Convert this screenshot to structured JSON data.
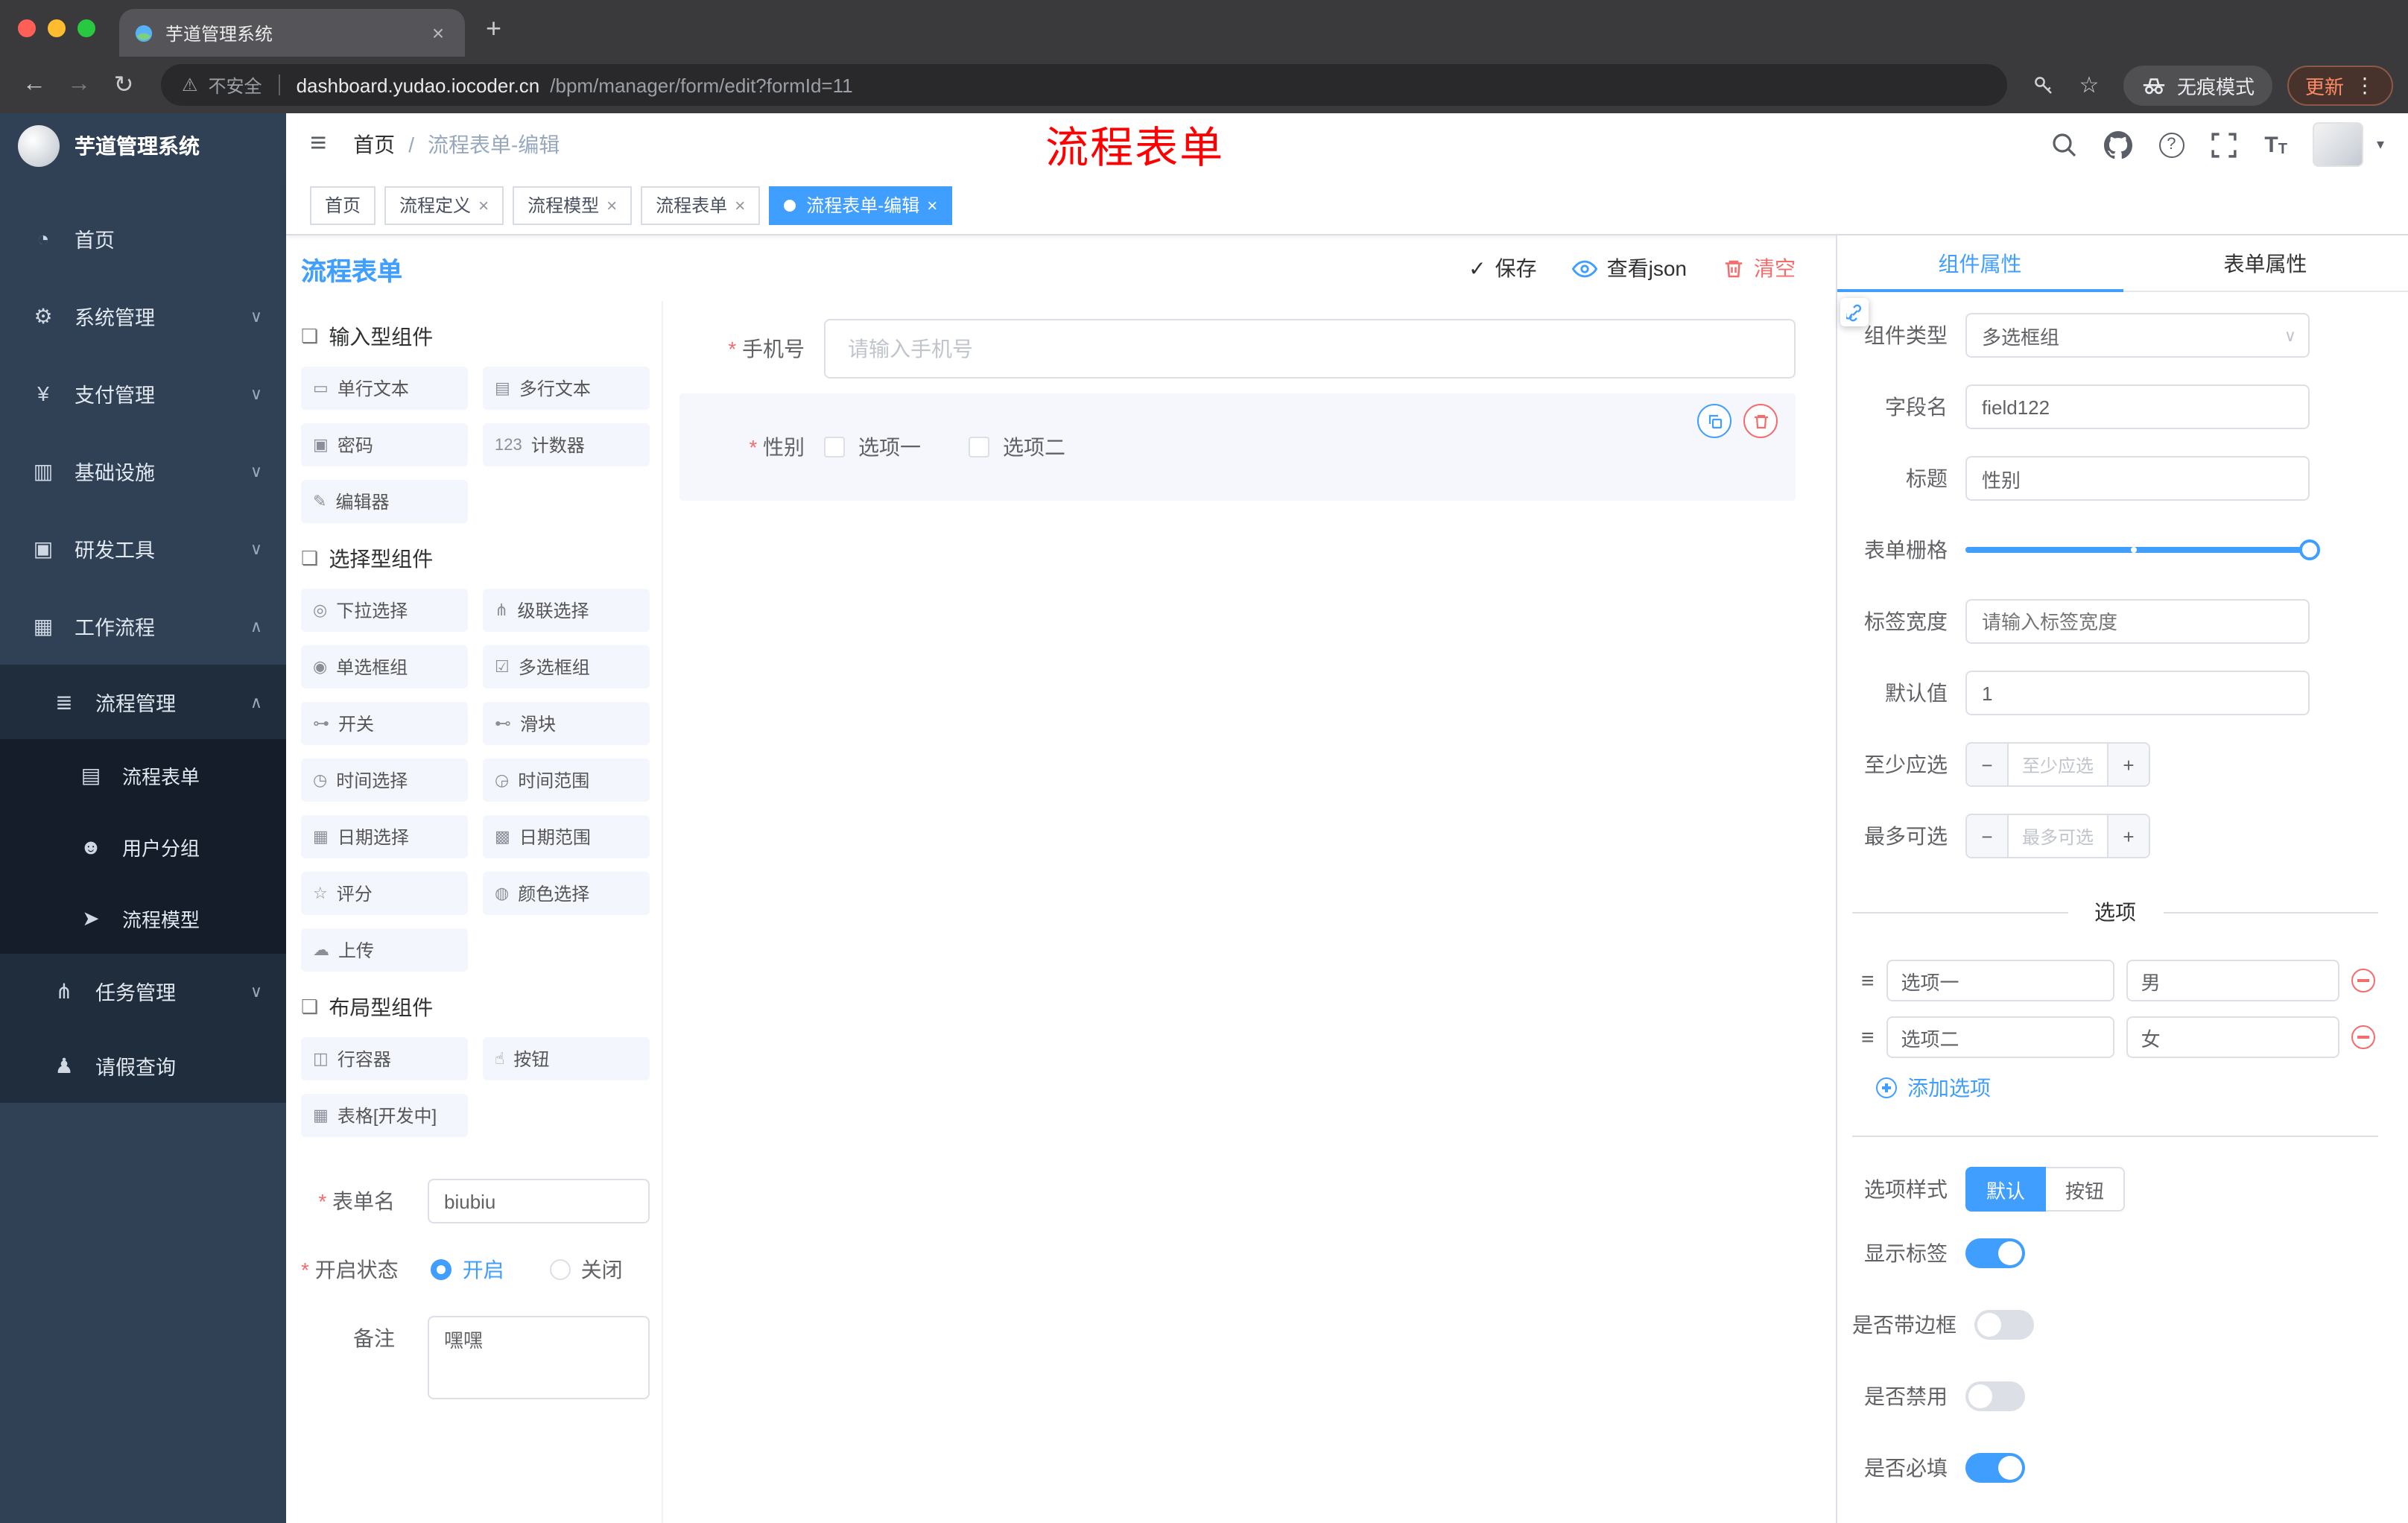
{
  "icons": {
    "back": "←",
    "forward": "→",
    "reload": "↻",
    "warning": "⚠",
    "star": "☆",
    "dots": "⋮",
    "new_tab": "+",
    "close": "×",
    "hamburger": "≡",
    "caret": "▾",
    "help": "?",
    "font_size": "T",
    "chevron_down": "∨",
    "minus": "−",
    "plus": "+",
    "check": "✓"
  },
  "browser": {
    "tab_title": "芋道管理系统",
    "security_label": "不安全",
    "url_host": "dashboard.yudao.iocoder.cn",
    "url_path": "/bpm/manager/form/edit?formId=11",
    "incognito_label": "无痕模式",
    "update_label": "更新"
  },
  "header": {
    "breadcrumb_home": "首页",
    "breadcrumb_sep": "/",
    "breadcrumb_current": "流程表单-编辑",
    "overlay_title": "流程表单"
  },
  "sidebar": {
    "logo_title": "芋道管理系统",
    "items": [
      {
        "icon": "◔",
        "label": "首页",
        "cls": "lvl1"
      },
      {
        "icon": "⚙",
        "label": "系统管理",
        "cls": "lvl1",
        "chevron": "∨"
      },
      {
        "icon": "¥",
        "label": "支付管理",
        "cls": "lvl1",
        "chevron": "∨"
      },
      {
        "icon": "▥",
        "label": "基础设施",
        "cls": "lvl1",
        "chevron": "∨"
      },
      {
        "icon": "▣",
        "label": "研发工具",
        "cls": "lvl1",
        "chevron": "∨"
      },
      {
        "icon": "▦",
        "label": "工作流程",
        "cls": "lvl1",
        "chevron": "∧"
      },
      {
        "icon": "≣",
        "label": "流程管理",
        "cls": "lvl2",
        "chevron": "∧"
      },
      {
        "icon": "▤",
        "label": "流程表单",
        "cls": "lvl3 active"
      },
      {
        "icon": "☻",
        "label": "用户分组",
        "cls": "lvl3"
      },
      {
        "icon": "➤",
        "label": "流程模型",
        "cls": "lvl3"
      },
      {
        "icon": "⋔",
        "label": "任务管理",
        "cls": "lvl2",
        "chevron": "∨"
      },
      {
        "icon": "♟",
        "label": "请假查询",
        "cls": "lvl2"
      }
    ]
  },
  "tags_view": {
    "tabs": [
      {
        "label": "首页"
      },
      {
        "label": "流程定义",
        "close": "×"
      },
      {
        "label": "流程模型",
        "close": "×"
      },
      {
        "label": "流程表单",
        "close": "×"
      },
      {
        "label": "流程表单-编辑",
        "close": "×",
        "cls": "active"
      }
    ]
  },
  "designer": {
    "panel_title": "流程表单",
    "toolbar": {
      "save": "保存",
      "view_json": "查看json",
      "clear": "清空"
    },
    "palette": {
      "sections": [
        {
          "icon": "❏",
          "title": "输入型组件",
          "items": [
            {
              "icon": "▭",
              "label": "单行文本"
            },
            {
              "icon": "▤",
              "label": "多行文本"
            },
            {
              "icon": "▣",
              "label": "密码"
            },
            {
              "icon": "123",
              "label": "计数器"
            },
            {
              "icon": "✎",
              "label": "编辑器"
            }
          ]
        },
        {
          "icon": "❏",
          "title": "选择型组件",
          "items": [
            {
              "icon": "◎",
              "label": "下拉选择"
            },
            {
              "icon": "⋔",
              "label": "级联选择"
            },
            {
              "icon": "◉",
              "label": "单选框组"
            },
            {
              "icon": "☑",
              "label": "多选框组"
            },
            {
              "icon": "⊶",
              "label": "开关"
            },
            {
              "icon": "⊷",
              "label": "滑块"
            },
            {
              "icon": "◷",
              "label": "时间选择"
            },
            {
              "icon": "◶",
              "label": "时间范围"
            },
            {
              "icon": "▦",
              "label": "日期选择"
            },
            {
              "icon": "▩",
              "label": "日期范围"
            },
            {
              "icon": "☆",
              "label": "评分"
            },
            {
              "icon": "◍",
              "label": "颜色选择"
            },
            {
              "icon": "☁",
              "label": "上传"
            }
          ]
        },
        {
          "icon": "❏",
          "title": "布局型组件",
          "items": [
            {
              "icon": "◫",
              "label": "行容器"
            },
            {
              "icon": "☝",
              "label": "按钮"
            },
            {
              "icon": "▦",
              "label": "表格[开发中]"
            }
          ]
        }
      ]
    },
    "meta_form": {
      "form_name_label": "表单名",
      "form_name_value": "biubiu",
      "status_label": "开启状态",
      "status_on": "开启",
      "status_off": "关闭",
      "remark_label": "备注",
      "remark_value": "嘿嘿"
    },
    "canvas": {
      "phone_label": "手机号",
      "phone_placeholder": "请输入手机号",
      "gender_label": "性别",
      "gender_options": [
        "选项一",
        "选项二"
      ]
    }
  },
  "properties": {
    "tab_component": "组件属性",
    "tab_form": "表单属性",
    "component_type_label": "组件类型",
    "component_type_value": "多选框组",
    "field_name_label": "字段名",
    "field_name_value": "field122",
    "title_label": "标题",
    "title_value": "性别",
    "grid_label": "表单栅格",
    "label_width_label": "标签宽度",
    "label_width_placeholder": "请输入标签宽度",
    "default_label": "默认值",
    "default_value": "1",
    "min_label": "至少应选",
    "min_placeholder": "至少应选",
    "max_label": "最多可选",
    "max_placeholder": "最多可选",
    "options_divider": "选项",
    "options": [
      {
        "drag": "≡",
        "label": "选项一",
        "value": "男"
      },
      {
        "drag": "≡",
        "label": "选项二",
        "value": "女"
      }
    ],
    "add_option": "添加选项",
    "option_style_label": "选项样式",
    "option_style_default": "默认",
    "option_style_button": "按钮",
    "switches": [
      {
        "label": "显示标签",
        "cls": "on"
      },
      {
        "label": "是否带边框"
      },
      {
        "label": "是否禁用"
      },
      {
        "label": "是否必填",
        "cls": "on"
      }
    ]
  },
  "colors": {
    "accent": "#409eff",
    "danger": "#f56c6c",
    "overlay_red": "#ff0000",
    "sidebar": "#304156"
  }
}
